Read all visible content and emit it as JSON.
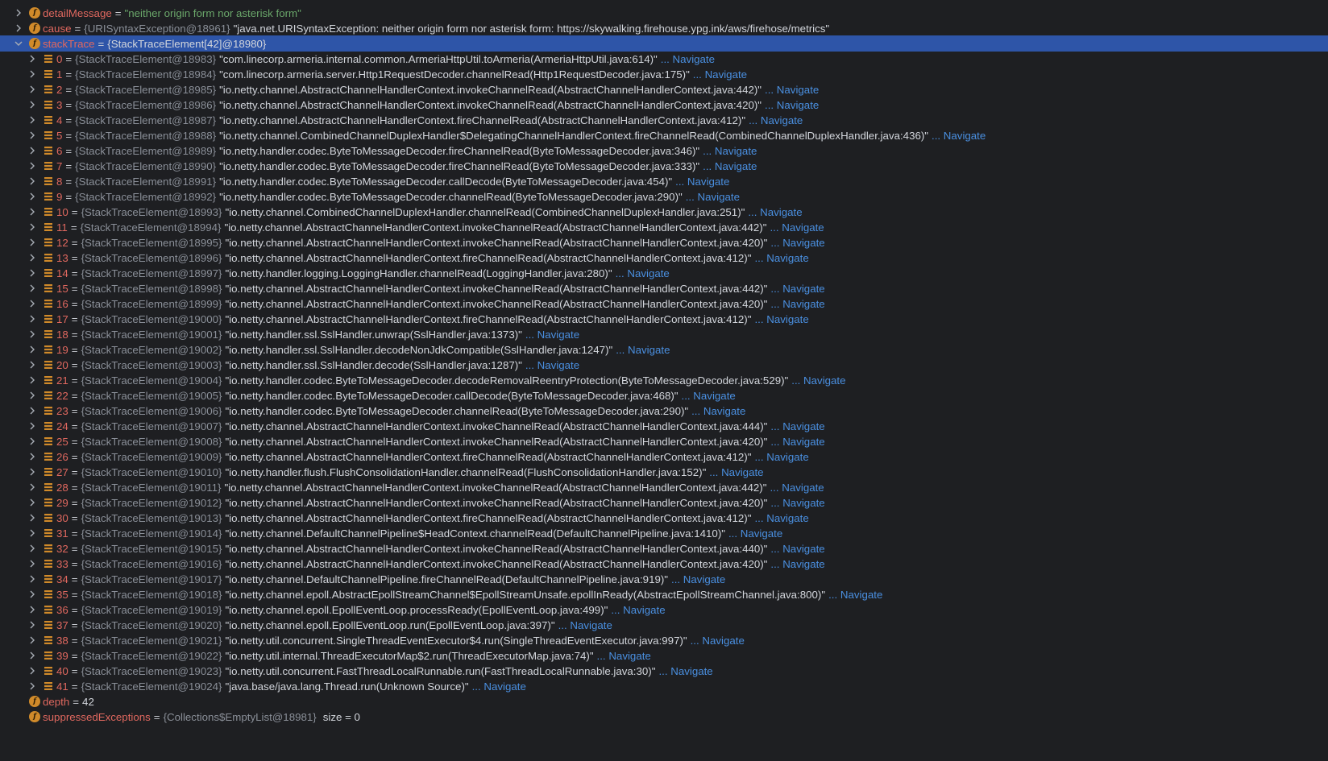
{
  "colors": {
    "background": "#1e1f22",
    "selected_row": "#2e55a8",
    "field_name": "#e0685f",
    "type_text": "#8a8f98",
    "string_value": "#6aa66a",
    "navigate_link": "#4a8fe0",
    "field_icon": "#d08a2a",
    "array_icon": "#d08a2a"
  },
  "navigate_label": "... Navigate",
  "top_fields": [
    {
      "icon": "field-icon",
      "name": "detailMessage",
      "eq": "=",
      "value": "\"neither origin form nor asterisk form\""
    },
    {
      "icon": "field-icon",
      "name": "cause",
      "eq": "=",
      "type": "{URISyntaxException@18961}",
      "value": "\"java.net.URISyntaxException: neither origin form nor asterisk form: https://skywalking.firehouse.ypg.ink/aws/firehose/metrics\""
    },
    {
      "icon": "field-icon",
      "name": "stackTrace",
      "eq": "=",
      "value": "{StackTraceElement[42]@18980}",
      "selected": true
    }
  ],
  "stack_elements": [
    {
      "index": "0",
      "ref": "{StackTraceElement@18983}",
      "frame": "\"com.linecorp.armeria.internal.common.ArmeriaHttpUtil.toArmeria(ArmeriaHttpUtil.java:614)\""
    },
    {
      "index": "1",
      "ref": "{StackTraceElement@18984}",
      "frame": "\"com.linecorp.armeria.server.Http1RequestDecoder.channelRead(Http1RequestDecoder.java:175)\""
    },
    {
      "index": "2",
      "ref": "{StackTraceElement@18985}",
      "frame": "\"io.netty.channel.AbstractChannelHandlerContext.invokeChannelRead(AbstractChannelHandlerContext.java:442)\""
    },
    {
      "index": "3",
      "ref": "{StackTraceElement@18986}",
      "frame": "\"io.netty.channel.AbstractChannelHandlerContext.invokeChannelRead(AbstractChannelHandlerContext.java:420)\""
    },
    {
      "index": "4",
      "ref": "{StackTraceElement@18987}",
      "frame": "\"io.netty.channel.AbstractChannelHandlerContext.fireChannelRead(AbstractChannelHandlerContext.java:412)\""
    },
    {
      "index": "5",
      "ref": "{StackTraceElement@18988}",
      "frame": "\"io.netty.channel.CombinedChannelDuplexHandler$DelegatingChannelHandlerContext.fireChannelRead(CombinedChannelDuplexHandler.java:436)\""
    },
    {
      "index": "6",
      "ref": "{StackTraceElement@18989}",
      "frame": "\"io.netty.handler.codec.ByteToMessageDecoder.fireChannelRead(ByteToMessageDecoder.java:346)\""
    },
    {
      "index": "7",
      "ref": "{StackTraceElement@18990}",
      "frame": "\"io.netty.handler.codec.ByteToMessageDecoder.fireChannelRead(ByteToMessageDecoder.java:333)\""
    },
    {
      "index": "8",
      "ref": "{StackTraceElement@18991}",
      "frame": "\"io.netty.handler.codec.ByteToMessageDecoder.callDecode(ByteToMessageDecoder.java:454)\""
    },
    {
      "index": "9",
      "ref": "{StackTraceElement@18992}",
      "frame": "\"io.netty.handler.codec.ByteToMessageDecoder.channelRead(ByteToMessageDecoder.java:290)\""
    },
    {
      "index": "10",
      "ref": "{StackTraceElement@18993}",
      "frame": "\"io.netty.channel.CombinedChannelDuplexHandler.channelRead(CombinedChannelDuplexHandler.java:251)\""
    },
    {
      "index": "11",
      "ref": "{StackTraceElement@18994}",
      "frame": "\"io.netty.channel.AbstractChannelHandlerContext.invokeChannelRead(AbstractChannelHandlerContext.java:442)\""
    },
    {
      "index": "12",
      "ref": "{StackTraceElement@18995}",
      "frame": "\"io.netty.channel.AbstractChannelHandlerContext.invokeChannelRead(AbstractChannelHandlerContext.java:420)\""
    },
    {
      "index": "13",
      "ref": "{StackTraceElement@18996}",
      "frame": "\"io.netty.channel.AbstractChannelHandlerContext.fireChannelRead(AbstractChannelHandlerContext.java:412)\""
    },
    {
      "index": "14",
      "ref": "{StackTraceElement@18997}",
      "frame": "\"io.netty.handler.logging.LoggingHandler.channelRead(LoggingHandler.java:280)\""
    },
    {
      "index": "15",
      "ref": "{StackTraceElement@18998}",
      "frame": "\"io.netty.channel.AbstractChannelHandlerContext.invokeChannelRead(AbstractChannelHandlerContext.java:442)\""
    },
    {
      "index": "16",
      "ref": "{StackTraceElement@18999}",
      "frame": "\"io.netty.channel.AbstractChannelHandlerContext.invokeChannelRead(AbstractChannelHandlerContext.java:420)\""
    },
    {
      "index": "17",
      "ref": "{StackTraceElement@19000}",
      "frame": "\"io.netty.channel.AbstractChannelHandlerContext.fireChannelRead(AbstractChannelHandlerContext.java:412)\""
    },
    {
      "index": "18",
      "ref": "{StackTraceElement@19001}",
      "frame": "\"io.netty.handler.ssl.SslHandler.unwrap(SslHandler.java:1373)\""
    },
    {
      "index": "19",
      "ref": "{StackTraceElement@19002}",
      "frame": "\"io.netty.handler.ssl.SslHandler.decodeNonJdkCompatible(SslHandler.java:1247)\""
    },
    {
      "index": "20",
      "ref": "{StackTraceElement@19003}",
      "frame": "\"io.netty.handler.ssl.SslHandler.decode(SslHandler.java:1287)\""
    },
    {
      "index": "21",
      "ref": "{StackTraceElement@19004}",
      "frame": "\"io.netty.handler.codec.ByteToMessageDecoder.decodeRemovalReentryProtection(ByteToMessageDecoder.java:529)\""
    },
    {
      "index": "22",
      "ref": "{StackTraceElement@19005}",
      "frame": "\"io.netty.handler.codec.ByteToMessageDecoder.callDecode(ByteToMessageDecoder.java:468)\""
    },
    {
      "index": "23",
      "ref": "{StackTraceElement@19006}",
      "frame": "\"io.netty.handler.codec.ByteToMessageDecoder.channelRead(ByteToMessageDecoder.java:290)\""
    },
    {
      "index": "24",
      "ref": "{StackTraceElement@19007}",
      "frame": "\"io.netty.channel.AbstractChannelHandlerContext.invokeChannelRead(AbstractChannelHandlerContext.java:444)\""
    },
    {
      "index": "25",
      "ref": "{StackTraceElement@19008}",
      "frame": "\"io.netty.channel.AbstractChannelHandlerContext.invokeChannelRead(AbstractChannelHandlerContext.java:420)\""
    },
    {
      "index": "26",
      "ref": "{StackTraceElement@19009}",
      "frame": "\"io.netty.channel.AbstractChannelHandlerContext.fireChannelRead(AbstractChannelHandlerContext.java:412)\""
    },
    {
      "index": "27",
      "ref": "{StackTraceElement@19010}",
      "frame": "\"io.netty.handler.flush.FlushConsolidationHandler.channelRead(FlushConsolidationHandler.java:152)\""
    },
    {
      "index": "28",
      "ref": "{StackTraceElement@19011}",
      "frame": "\"io.netty.channel.AbstractChannelHandlerContext.invokeChannelRead(AbstractChannelHandlerContext.java:442)\""
    },
    {
      "index": "29",
      "ref": "{StackTraceElement@19012}",
      "frame": "\"io.netty.channel.AbstractChannelHandlerContext.invokeChannelRead(AbstractChannelHandlerContext.java:420)\""
    },
    {
      "index": "30",
      "ref": "{StackTraceElement@19013}",
      "frame": "\"io.netty.channel.AbstractChannelHandlerContext.fireChannelRead(AbstractChannelHandlerContext.java:412)\""
    },
    {
      "index": "31",
      "ref": "{StackTraceElement@19014}",
      "frame": "\"io.netty.channel.DefaultChannelPipeline$HeadContext.channelRead(DefaultChannelPipeline.java:1410)\""
    },
    {
      "index": "32",
      "ref": "{StackTraceElement@19015}",
      "frame": "\"io.netty.channel.AbstractChannelHandlerContext.invokeChannelRead(AbstractChannelHandlerContext.java:440)\""
    },
    {
      "index": "33",
      "ref": "{StackTraceElement@19016}",
      "frame": "\"io.netty.channel.AbstractChannelHandlerContext.invokeChannelRead(AbstractChannelHandlerContext.java:420)\""
    },
    {
      "index": "34",
      "ref": "{StackTraceElement@19017}",
      "frame": "\"io.netty.channel.DefaultChannelPipeline.fireChannelRead(DefaultChannelPipeline.java:919)\""
    },
    {
      "index": "35",
      "ref": "{StackTraceElement@19018}",
      "frame": "\"io.netty.channel.epoll.AbstractEpollStreamChannel$EpollStreamUnsafe.epollInReady(AbstractEpollStreamChannel.java:800)\""
    },
    {
      "index": "36",
      "ref": "{StackTraceElement@19019}",
      "frame": "\"io.netty.channel.epoll.EpollEventLoop.processReady(EpollEventLoop.java:499)\""
    },
    {
      "index": "37",
      "ref": "{StackTraceElement@19020}",
      "frame": "\"io.netty.channel.epoll.EpollEventLoop.run(EpollEventLoop.java:397)\""
    },
    {
      "index": "38",
      "ref": "{StackTraceElement@19021}",
      "frame": "\"io.netty.util.concurrent.SingleThreadEventExecutor$4.run(SingleThreadEventExecutor.java:997)\""
    },
    {
      "index": "39",
      "ref": "{StackTraceElement@19022}",
      "frame": "\"io.netty.util.internal.ThreadExecutorMap$2.run(ThreadExecutorMap.java:74)\""
    },
    {
      "index": "40",
      "ref": "{StackTraceElement@19023}",
      "frame": "\"io.netty.util.concurrent.FastThreadLocalRunnable.run(FastThreadLocalRunnable.java:30)\""
    },
    {
      "index": "41",
      "ref": "{StackTraceElement@19024}",
      "frame": "\"java.base/java.lang.Thread.run(Unknown Source)\""
    }
  ],
  "bottom_fields": [
    {
      "icon": "field-icon",
      "name": "depth",
      "eq": "=",
      "value": "42"
    },
    {
      "icon": "field-icon",
      "name": "suppressedExceptions",
      "eq": "=",
      "type": "{Collections$EmptyList@18981}",
      "size": "size = 0"
    }
  ]
}
